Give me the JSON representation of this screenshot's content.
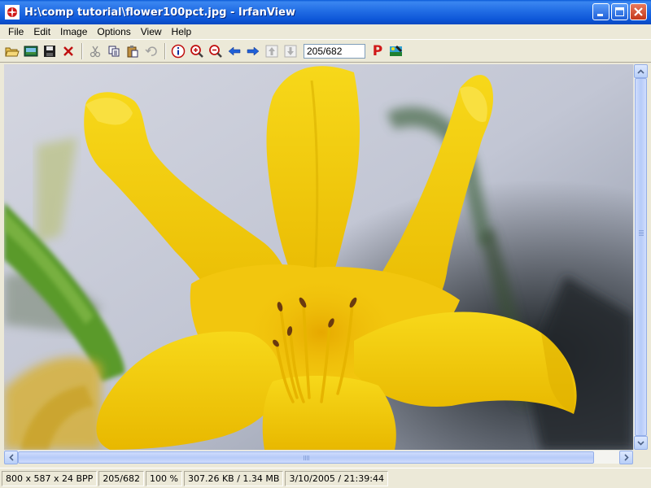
{
  "window": {
    "title": "H:\\comp tutorial\\flower100pct.jpg - IrfanView"
  },
  "menu": {
    "items": [
      {
        "label": "File"
      },
      {
        "label": "Edit"
      },
      {
        "label": "Image"
      },
      {
        "label": "Options"
      },
      {
        "label": "View"
      },
      {
        "label": "Help"
      }
    ]
  },
  "toolbar": {
    "page_value": "205/682",
    "icons": [
      "open-folder-icon",
      "slideshow-icon",
      "save-icon",
      "delete-icon",
      "cut-icon",
      "copy-icon",
      "paste-icon",
      "undo-icon",
      "info-icon",
      "zoom-in-icon",
      "zoom-out-icon",
      "previous-arrow-icon",
      "next-arrow-icon",
      "first-page-icon",
      "last-page-icon",
      "print-icon",
      "paint-icon"
    ],
    "print_glyph": "P"
  },
  "statusbar": {
    "dimensions": "800 x 587 x 24 BPP",
    "position": "205/682",
    "zoom": "100 %",
    "file_size": "307.26 KB / 1.34 MB",
    "datetime": "3/10/2005 / 21:39:44"
  },
  "colors": {
    "titlebar": "#0a5ad8",
    "flower": "#f5d00a",
    "background_sky": "#c8cbd6"
  }
}
